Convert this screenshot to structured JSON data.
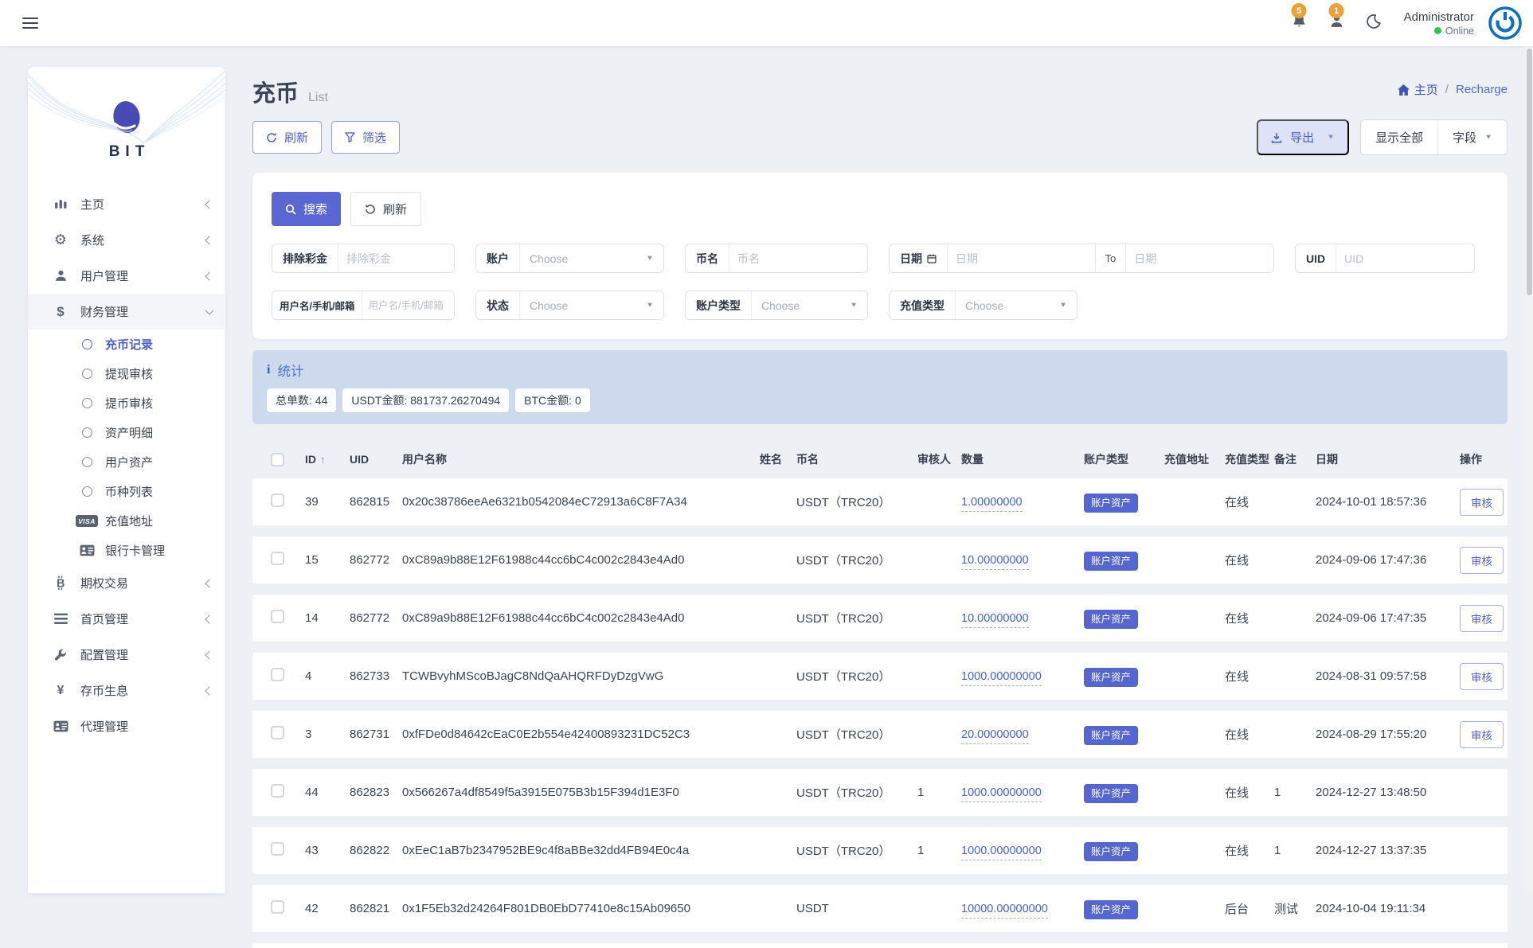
{
  "colors": {
    "accent": "#5a67d3",
    "badge": "#5666cf",
    "link": "#4a63d0",
    "stats_bg": "#cdd9ec",
    "notification_badge": "#e9a23b",
    "online": "#2fc25b",
    "avatar_blue": "#0c6fc5"
  },
  "topbar": {
    "notifications": [
      {
        "icon": "bell-icon",
        "badge": "5"
      },
      {
        "icon": "person-icon",
        "badge": "1"
      }
    ],
    "user": {
      "name": "Administrator",
      "status": "Online"
    }
  },
  "sidebar": {
    "logo_text": "BIT",
    "items": [
      {
        "label": "主页",
        "icon": "bar-chart-icon",
        "chevron": "left"
      },
      {
        "label": "系统",
        "icon": "gear-icon",
        "chevron": "left"
      },
      {
        "label": "用户管理",
        "icon": "user-icon",
        "chevron": "left"
      },
      {
        "label": "财务管理",
        "icon": "dollar-icon",
        "chevron": "down",
        "expanded": true,
        "children": [
          {
            "label": "充币记录",
            "icon": "circle-icon",
            "active": true
          },
          {
            "label": "提现审核",
            "icon": "circle-icon"
          },
          {
            "label": "提币审核",
            "icon": "circle-icon"
          },
          {
            "label": "资产明细",
            "icon": "circle-icon"
          },
          {
            "label": "用户资产",
            "icon": "circle-icon"
          },
          {
            "label": "币种列表",
            "icon": "circle-icon"
          },
          {
            "label": "充值地址",
            "icon": "visa-icon"
          },
          {
            "label": "银行卡管理",
            "icon": "id-card-icon"
          }
        ]
      },
      {
        "label": "期权交易",
        "icon": "bitcoin-icon",
        "chevron": "left"
      },
      {
        "label": "首页管理",
        "icon": "list-icon",
        "chevron": "left"
      },
      {
        "label": "配置管理",
        "icon": "wrench-icon",
        "chevron": "left"
      },
      {
        "label": "存币生息",
        "icon": "yen-icon",
        "chevron": "left"
      },
      {
        "label": "代理管理",
        "icon": "id-card-icon",
        "chevron": "none"
      }
    ]
  },
  "page": {
    "title": "充币",
    "subtitle": "List"
  },
  "breadcrumb": {
    "home_label": "主页",
    "separator": "/",
    "current": "Recharge"
  },
  "actions": {
    "refresh": "刷新",
    "filter": "筛选",
    "export": "导出",
    "display_all": "显示全部",
    "fields": "字段"
  },
  "filter_panel": {
    "search": "搜索",
    "reset": "刷新",
    "rows": [
      [
        {
          "label": "排除彩金",
          "type": "text",
          "placeholder": "排除彩金"
        },
        {
          "label": "账户",
          "type": "select",
          "value": "Choose"
        },
        {
          "label": "币名",
          "type": "text",
          "placeholder": "币名"
        },
        {
          "label": "日期",
          "type": "daterange",
          "icon": "calendar-icon",
          "from_placeholder": "日期",
          "to_label": "To",
          "to_placeholder": "日期"
        },
        {
          "label": "UID",
          "type": "text",
          "placeholder": "UID"
        }
      ],
      [
        {
          "label": "用户名/手机/邮箱",
          "type": "text",
          "placeholder": "用户名/手机/邮箱"
        },
        {
          "label": "状态",
          "type": "select",
          "value": "Choose"
        },
        {
          "label": "账户类型",
          "type": "select",
          "value": "Choose"
        },
        {
          "label": "充值类型",
          "type": "select",
          "value": "Choose"
        }
      ]
    ]
  },
  "stats": {
    "title": "统计",
    "pills": [
      {
        "label": "总单数:",
        "value": "44"
      },
      {
        "label": "USDT金额:",
        "value": "881737.26270494"
      },
      {
        "label": "BTC金额:",
        "value": "0"
      }
    ]
  },
  "table": {
    "headers": [
      "ID",
      "UID",
      "用户名称",
      "姓名",
      "币名",
      "审核人",
      "数量",
      "账户类型",
      "充值地址",
      "充值类型",
      "备注",
      "日期",
      "操作"
    ],
    "sort_column": "ID",
    "rows": [
      {
        "id": "39",
        "uid": "862815",
        "username": "0x20c38786eeAe6321b0542084eC72913a6C8F7A34",
        "name": "",
        "coin": "USDT（TRC20）",
        "reviewer": "",
        "amount": "1.00000000",
        "account_type": "账户资产",
        "recharge_address": "",
        "recharge_type": "在线",
        "remark": "",
        "date": "2024-10-01 18:57:36",
        "action": "审核"
      },
      {
        "id": "15",
        "uid": "862772",
        "username": "0xC89a9b88E12F61988c44cc6bC4c002c2843e4Ad0",
        "name": "",
        "coin": "USDT（TRC20）",
        "reviewer": "",
        "amount": "10.00000000",
        "account_type": "账户资产",
        "recharge_address": "",
        "recharge_type": "在线",
        "remark": "",
        "date": "2024-09-06 17:47:36",
        "action": "审核"
      },
      {
        "id": "14",
        "uid": "862772",
        "username": "0xC89a9b88E12F61988c44cc6bC4c002c2843e4Ad0",
        "name": "",
        "coin": "USDT（TRC20）",
        "reviewer": "",
        "amount": "10.00000000",
        "account_type": "账户资产",
        "recharge_address": "",
        "recharge_type": "在线",
        "remark": "",
        "date": "2024-09-06 17:47:35",
        "action": "审核"
      },
      {
        "id": "4",
        "uid": "862733",
        "username": "TCWBvyhMScoBJagC8NdQaAHQRFDyDzgVwG",
        "name": "",
        "coin": "USDT（TRC20）",
        "reviewer": "",
        "amount": "1000.00000000",
        "account_type": "账户资产",
        "recharge_address": "",
        "recharge_type": "在线",
        "remark": "",
        "date": "2024-08-31 09:57:58",
        "action": "审核"
      },
      {
        "id": "3",
        "uid": "862731",
        "username": "0xfFDe0d84642cEaC0E2b554e42400893231DC52C3",
        "name": "",
        "coin": "USDT（TRC20）",
        "reviewer": "",
        "amount": "20.00000000",
        "account_type": "账户资产",
        "recharge_address": "",
        "recharge_type": "在线",
        "remark": "",
        "date": "2024-08-29 17:55:20",
        "action": "审核"
      },
      {
        "id": "44",
        "uid": "862823",
        "username": "0x566267a4df8549f5a3915E075B3b15F394d1E3F0",
        "name": "",
        "coin": "USDT（TRC20）",
        "reviewer": "1",
        "amount": "1000.00000000",
        "account_type": "账户资产",
        "recharge_address": "",
        "recharge_type": "在线",
        "remark": "1",
        "date": "2024-12-27 13:48:50",
        "action": ""
      },
      {
        "id": "43",
        "uid": "862822",
        "username": "0xEeC1aB7b2347952BE9c4f8aBBe32dd4FB94E0c4a",
        "name": "",
        "coin": "USDT（TRC20）",
        "reviewer": "1",
        "amount": "1000.00000000",
        "account_type": "账户资产",
        "recharge_address": "",
        "recharge_type": "在线",
        "remark": "1",
        "date": "2024-12-27 13:37:35",
        "action": ""
      },
      {
        "id": "42",
        "uid": "862821",
        "username": "0x1F5Eb32d24264F801DB0EbD77410e8c15Ab09650",
        "name": "",
        "coin": "USDT",
        "reviewer": "",
        "amount": "10000.00000000",
        "account_type": "账户资产",
        "recharge_address": "",
        "recharge_type": "后台",
        "remark": "测试",
        "date": "2024-10-04 19:11:34",
        "action": ""
      }
    ]
  }
}
